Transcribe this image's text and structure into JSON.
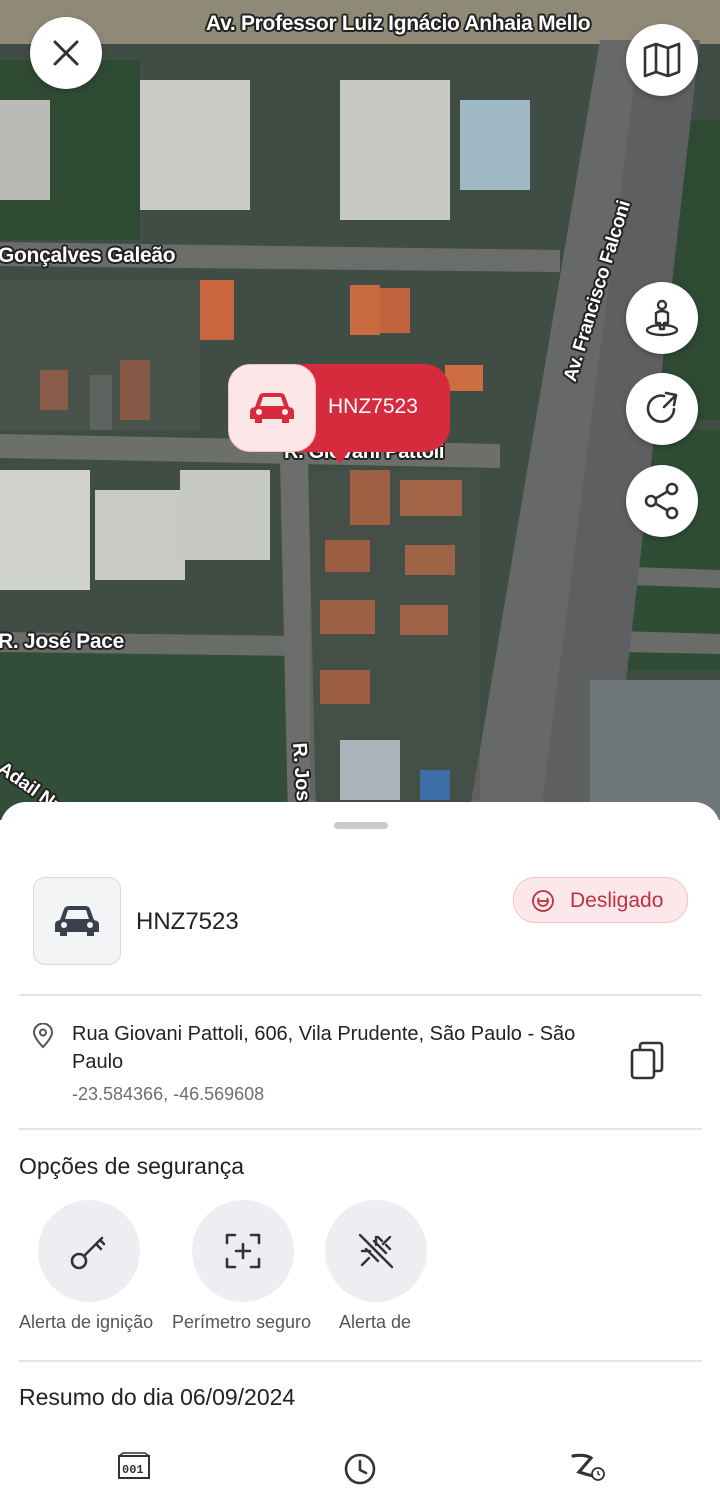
{
  "map": {
    "streets": [
      "Av. Professor Luiz Ignácio Anhaia Mello",
      "Gonçalves Galeão",
      "Av. Francisco Falconi",
      "R. Giovani Pattoli",
      "R. José Pace",
      "R. Jos",
      "Adail Nu"
    ],
    "marker_plate": "HNZ7523",
    "icons": [
      "close-icon",
      "map-icon",
      "street-view-icon",
      "refresh-icon",
      "share-icon",
      "car-icon"
    ]
  },
  "vehicle": {
    "plate": "HNZ7523",
    "icon": "car-icon",
    "status": "Desligado",
    "status_color": "#c0303f"
  },
  "location": {
    "address": "Rua Giovani Pattoli, 606, Vila Prudente, São Paulo - São Paulo",
    "coords": "-23.584366, -46.569608"
  },
  "security": {
    "title": "Opções de segurança",
    "options": [
      {
        "label": "Alerta de ignição",
        "icon": "key-icon"
      },
      {
        "label": "Perímetro seguro",
        "icon": "perimeter-icon"
      },
      {
        "label": "Alerta de",
        "icon": "unplug-icon"
      }
    ]
  },
  "summary": {
    "title": "Resumo do dia 06/09/2024",
    "tabs": [
      {
        "icon": "odometer-icon"
      },
      {
        "icon": "clock-icon"
      },
      {
        "icon": "speed-time-icon"
      }
    ]
  },
  "colors": {
    "accent": "#d62b3c",
    "accent_light": "#fde6e8"
  }
}
